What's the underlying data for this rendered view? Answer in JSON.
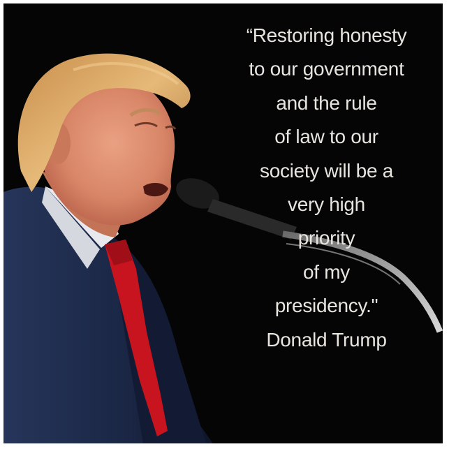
{
  "quote": {
    "lines": [
      "“Restoring honesty",
      "to our government",
      "and the rule",
      "of law to our",
      "society will be a",
      "very high",
      "priority",
      "of my",
      "presidency.\""
    ],
    "attribution": "Donald Trump"
  },
  "colors": {
    "background": "#050505",
    "text": "#e8e4df",
    "suit": "#1c2a4a",
    "tie": "#c8141e",
    "hair": "#d9a866",
    "skin": "#d98c6a"
  }
}
